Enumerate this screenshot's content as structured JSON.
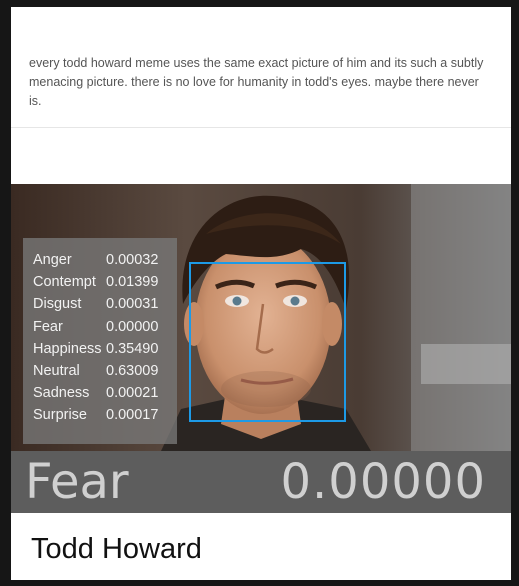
{
  "post": {
    "text": "every todd howard meme uses the same exact picture of him and its such a subtly menacing picture. there is no love for humanity in todd's eyes. maybe there never is."
  },
  "emotion_panel": {
    "items": [
      {
        "label": "Anger",
        "value": "0.00032"
      },
      {
        "label": "Contempt",
        "value": "0.01399"
      },
      {
        "label": "Disgust",
        "value": "0.00031"
      },
      {
        "label": "Fear",
        "value": "0.00000"
      },
      {
        "label": "Happiness",
        "value": "0.35490"
      },
      {
        "label": "Neutral",
        "value": "0.63009"
      },
      {
        "label": "Sadness",
        "value": "0.00021"
      },
      {
        "label": "Surprise",
        "value": "0.00017"
      }
    ]
  },
  "bottom_bar": {
    "emotion": "Fear",
    "score": "0.00000"
  },
  "caption": "Todd Howard",
  "colors": {
    "face_box": "#1d9ae6",
    "panel_bg": "#787878",
    "bar_bg": "#5d5d5d"
  }
}
